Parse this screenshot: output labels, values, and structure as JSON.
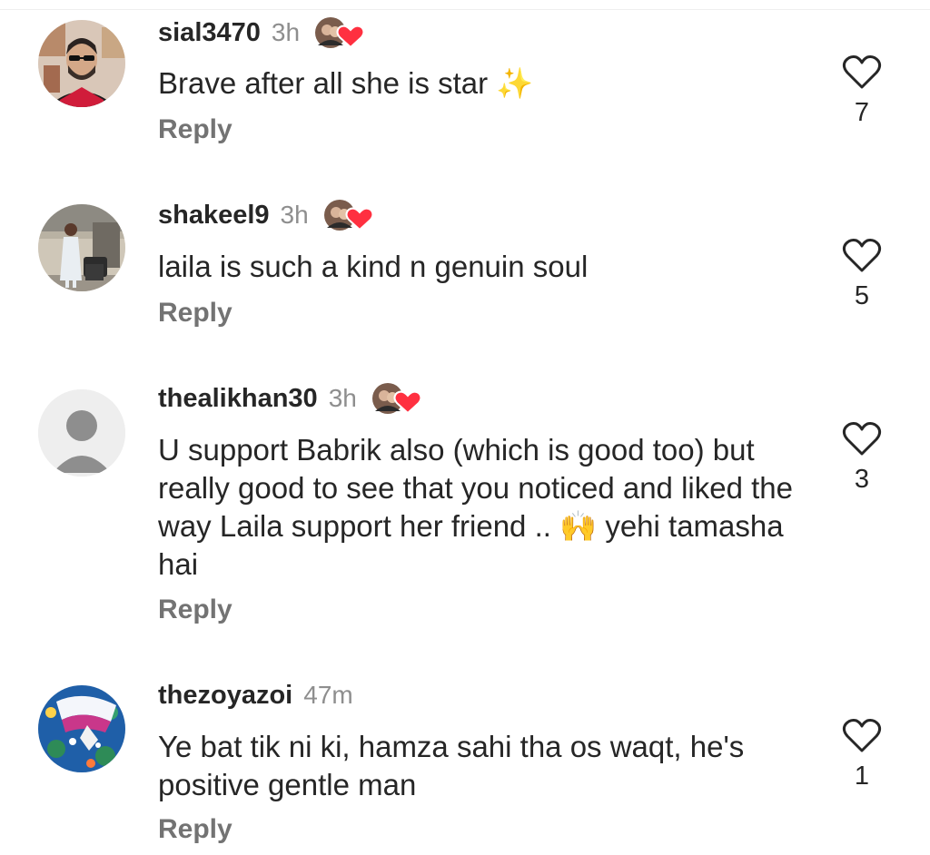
{
  "comments": [
    {
      "username": "sial3470",
      "time": "3h",
      "text": "Brave after all she is star ✨",
      "reply_label": "Reply",
      "likes": "7",
      "avatar": "man-with-sunglasses-photo"
    },
    {
      "username": "shakeel9",
      "time": "3h",
      "text": "laila is such a kind n genuin soul",
      "reply_label": "Reply",
      "likes": "5",
      "avatar": "woman-in-airport-photo"
    },
    {
      "username": "thealikhan30",
      "time": "3h",
      "text": "U support Babrik also (which is good too) but really good to see that you noticed and liked the way Laila support her friend .. 🙌 yehi tamasha hai",
      "reply_label": "Reply",
      "likes": "3",
      "avatar": "default-profile-icon"
    },
    {
      "username": "thezoyazoi",
      "time": "47m",
      "text": "Ye bat tik ni ki,  hamza sahi tha os waqt, he's positive gentle man",
      "reply_label": "Reply",
      "likes": "1",
      "avatar": "blue-floral-dress-photo"
    }
  ],
  "colors": {
    "username": "#262626",
    "time": "#8e8e8e",
    "reply": "#737373",
    "heart": "#ff3040",
    "like_outline": "#262626"
  },
  "icons": {
    "like": "heart-outline-icon",
    "creator_like": "creator-liked-heart-icon"
  }
}
